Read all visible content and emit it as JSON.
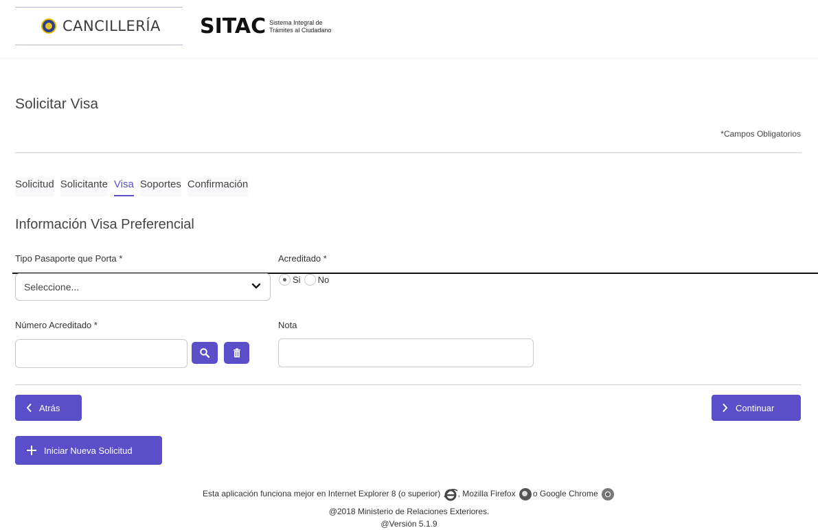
{
  "header": {
    "cancilleria_logo_text": "CANCILLERÍA",
    "sitac_logo_word": "SITAC",
    "sitac_subtitle_line1": "Sistema Integral de",
    "sitac_subtitle_line2": "Trámites al Ciudadano"
  },
  "page": {
    "title": "Solicitar Visa",
    "required_note": "*Campos Obligatorios"
  },
  "tabs": [
    {
      "label": "Solicitud",
      "active": false
    },
    {
      "label": "Solicitante",
      "active": false
    },
    {
      "label": "Visa",
      "active": true
    },
    {
      "label": "Soportes",
      "active": false
    },
    {
      "label": "Confirmación",
      "active": false
    }
  ],
  "section": {
    "title": "Información Visa Preferencial"
  },
  "form": {
    "passport_type_label": "Tipo Pasaporte que Porta *",
    "passport_type_value": "Seleccione...",
    "accredited_label": "Acreditado *",
    "accredited_options": [
      "Si",
      "No"
    ],
    "accredited_selected": "Si",
    "accredited_number_label": "Número Acreditado *",
    "accredited_number_value": "",
    "note_label": "Nota",
    "note_value": ""
  },
  "actions": {
    "back_label": "Atrás",
    "continue_label": "Continuar",
    "new_request_label": "Iniciar Nueva Solicitud"
  },
  "footer": {
    "browser_text_1": "Esta aplicación funciona mejor en Internet Explorer 8 (o superior)",
    "browser_text_2": ", Mozilla Firefox",
    "browser_text_3": "o Google Chrome",
    "copyright": "@2018 Ministerio de Relaciones Exteriores.",
    "version": "@Versión 5.1.9"
  },
  "colors": {
    "accent": "#5b4fc9",
    "divider": "#cfcfcf"
  }
}
